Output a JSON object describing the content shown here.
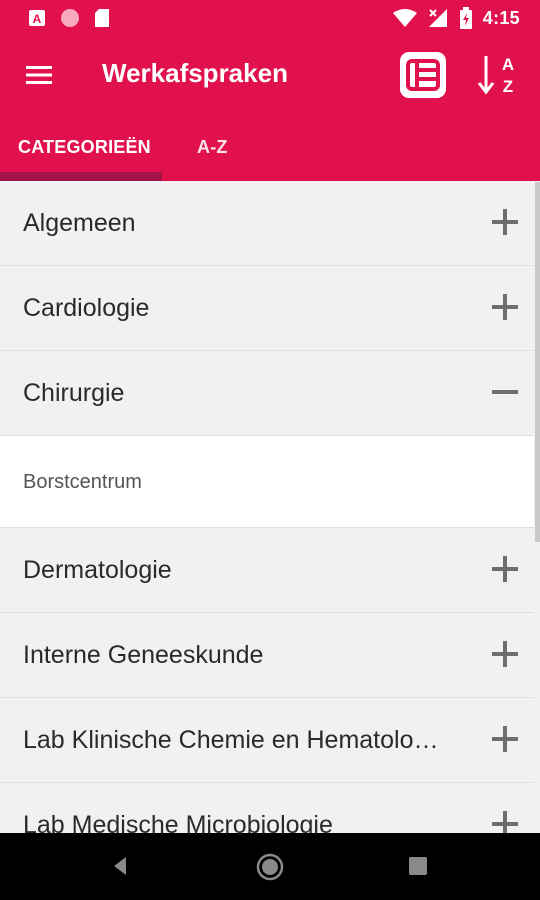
{
  "status_bar": {
    "time": "4:15",
    "icons": [
      "a-notification-icon",
      "circle-notification-icon",
      "sd-card-icon",
      "wifi-icon",
      "signal-icon",
      "battery-icon"
    ]
  },
  "app_bar": {
    "title": "Werkafspraken",
    "menu_icon": "menu-icon",
    "actions": [
      "list-view-icon",
      "sort-a-z-icon"
    ]
  },
  "tabs": [
    {
      "label": "CATEGORIEËN",
      "active": true
    },
    {
      "label": "A-Z",
      "active": false
    }
  ],
  "categories": [
    {
      "label": "Algemeen",
      "expanded": false
    },
    {
      "label": "Cardiologie",
      "expanded": false
    },
    {
      "label": "Chirurgie",
      "expanded": true,
      "children": [
        "Borstcentrum"
      ]
    },
    {
      "label": "Dermatologie",
      "expanded": false
    },
    {
      "label": "Interne Geneeskunde",
      "expanded": false
    },
    {
      "label": "Lab Klinische Chemie en Hematologie",
      "expanded": false
    },
    {
      "label": "Lab Medische Microbiologie",
      "expanded": false
    }
  ],
  "colors": {
    "primary": "#e1114e",
    "tab_indicator": "#a2134a",
    "list_bg": "#f1f1f3",
    "sub_bg": "#ffffff"
  }
}
